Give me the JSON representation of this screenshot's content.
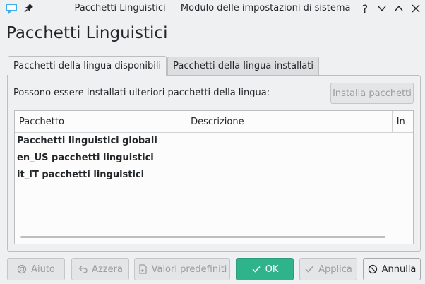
{
  "window": {
    "title": "Pacchetti Linguistici — Modulo delle impostazioni di sistema",
    "help_glyph": "?"
  },
  "page_title": "Pacchetti Linguistici",
  "tabs": [
    {
      "label": "Pacchetti della lingua disponibili",
      "active": true
    },
    {
      "label": "Pacchetti della lingua installati",
      "active": false
    }
  ],
  "panel": {
    "description": "Possono essere installati ulteriori pacchetti della lingua:",
    "install_button": "Installa pacchetti"
  },
  "table": {
    "columns": [
      "Pacchetto",
      "Descrizione",
      "In"
    ],
    "rows": [
      "Pacchetti linguistici globali",
      "en_US pacchetti linguistici",
      "it_IT pacchetti linguistici"
    ]
  },
  "buttons": {
    "help": "Aiuto",
    "reset": "Azzera",
    "defaults": "Valori predefiniti",
    "ok": "OK",
    "apply": "Applica",
    "cancel": "Annulla"
  },
  "colors": {
    "accent": "#2eb38a",
    "background": "#eff0f1",
    "icon_blue": "#3daee9"
  }
}
